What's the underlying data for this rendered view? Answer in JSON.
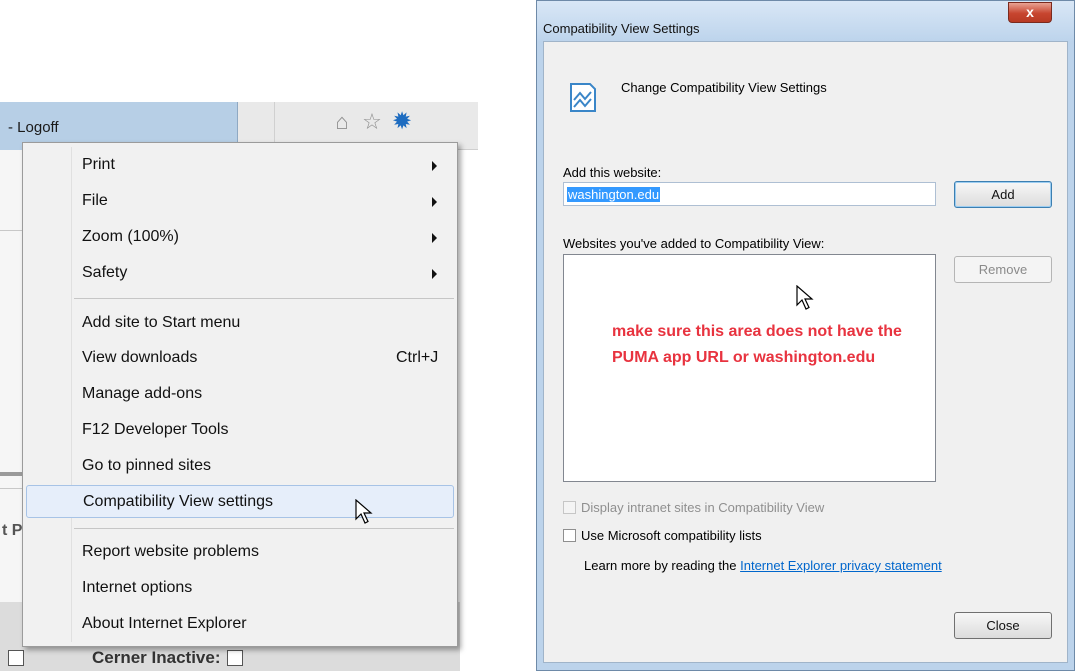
{
  "browser": {
    "tab_text": "- Logoff",
    "toolbar_icons": [
      "home-icon",
      "star-icon",
      "gear-icon"
    ],
    "footer": {
      "label": "Cerner Inactive:",
      "fragment": "t P"
    },
    "tools_menu": {
      "groups": [
        [
          {
            "label": "Print",
            "submenu": true
          },
          {
            "label": "File",
            "submenu": true
          },
          {
            "label": "Zoom (100%)",
            "submenu": true
          },
          {
            "label": "Safety",
            "submenu": true
          }
        ],
        [
          {
            "label": "Add site to Start menu"
          },
          {
            "label": "View downloads",
            "shortcut": "Ctrl+J"
          },
          {
            "label": "Manage add-ons"
          },
          {
            "label": "F12 Developer Tools"
          },
          {
            "label": "Go to pinned sites"
          },
          {
            "label": "Compatibility View settings",
            "highlighted": true
          }
        ],
        [
          {
            "label": "Report website problems"
          },
          {
            "label": "Internet options"
          },
          {
            "label": "About Internet Explorer"
          }
        ]
      ]
    }
  },
  "dialog": {
    "title": "Compatibility View Settings",
    "close_glyph": "x",
    "header_text": "Change Compatibility View Settings",
    "add_label": "Add this website:",
    "add_value": "washington.edu",
    "add_button": "Add",
    "list_label": "Websites you've added to Compatibility View:",
    "remove_button": "Remove",
    "annotation": "make sure this area does not have the PUMA app URL or washington.edu",
    "checkbox_intranet": "Display intranet sites in Compatibility View",
    "checkbox_ms_lists": "Use Microsoft compatibility lists",
    "learn_more_prefix": "Learn more by reading the",
    "learn_more_link": "Internet Explorer privacy statement",
    "close_button": "Close",
    "colors": {
      "annotation": "#e8333f",
      "link": "#0066cc",
      "selection": "#3399ff"
    }
  }
}
